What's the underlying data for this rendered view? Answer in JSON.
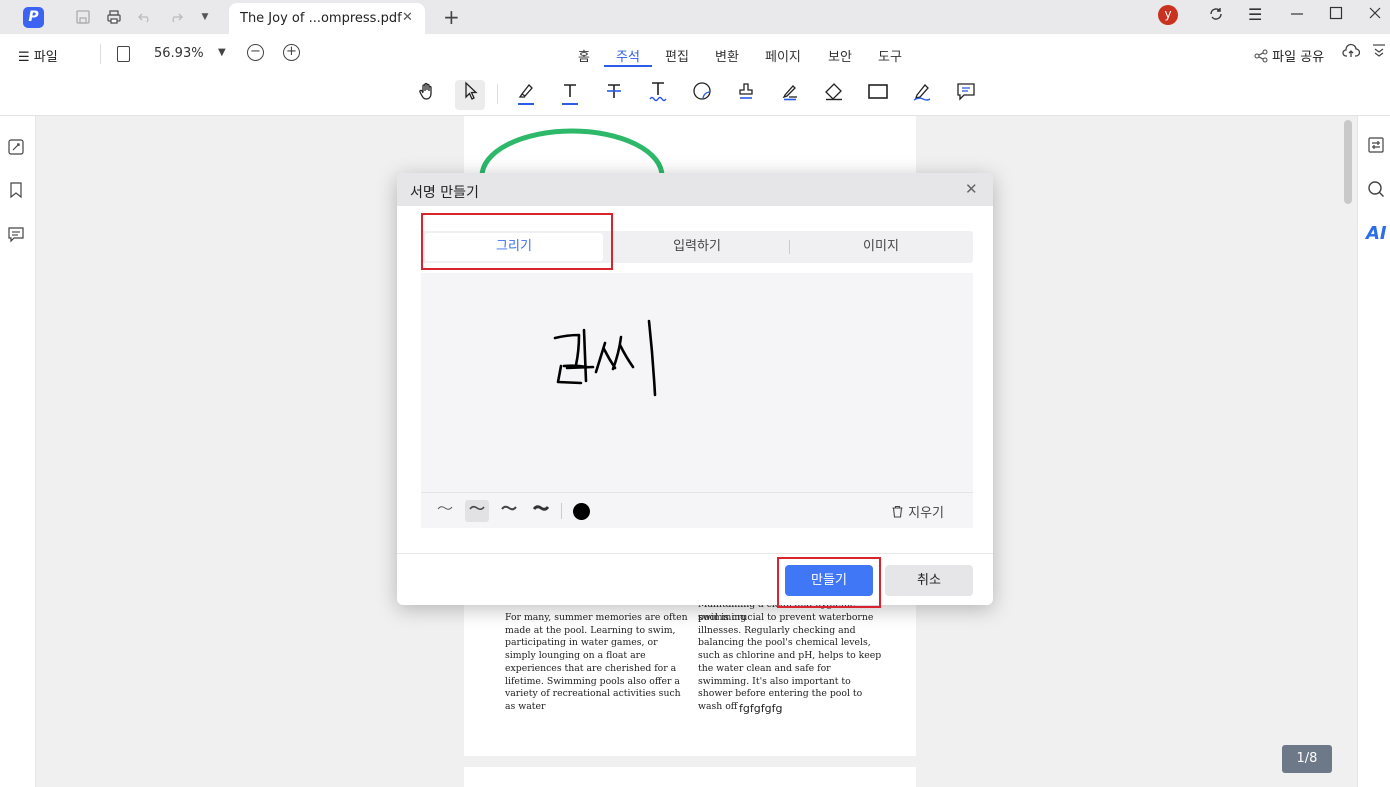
{
  "titlebar": {
    "tab_title": "The Joy of ...ompress.pdf",
    "avatar_letter": "y"
  },
  "menubar": {
    "file_label": "파일",
    "zoom": "56.93%",
    "tabs": [
      "홈",
      "주석",
      "편집",
      "변환",
      "페이지",
      "보안",
      "도구"
    ],
    "active_tab": "주석",
    "share_label": "파일 공유"
  },
  "toolbar": {
    "tools": [
      "hand-icon",
      "cursor-icon",
      "highlight-icon",
      "underline-text-icon",
      "strikethrough-icon",
      "squiggly-icon",
      "sticky-note-icon",
      "stamp-icon",
      "pencil-icon",
      "eraser-icon",
      "rectangle-icon",
      "signature-icon",
      "comment-icon"
    ],
    "selected_tool": "cursor-icon"
  },
  "right_sidebar": {
    "ai_label": "AI"
  },
  "pdf": {
    "col1": "For many, summer memories are often made at the pool. Learning to swim, participating in water games, or simply lounging on a float are experiences that are cherished for a lifetime. Swimming pools also offer a variety of recreational activities such as water",
    "col2_top": "Maintaining a clean and hygienic swimming",
    "col2": "pool is crucial to prevent waterborne illnesses. Regularly checking and balancing the pool's chemical levels, such as chlorine and pH, helps to keep the water clean and safe for swimming. It's also important to shower before entering the pool to wash off",
    "footer": "fgfgfgfg"
  },
  "page_counter": "1/8",
  "dialog": {
    "title": "서명 만들기",
    "tabs": [
      "그리기",
      "입력하기",
      "이미지"
    ],
    "active_tab": "그리기",
    "clear_label": "지우기",
    "pen_color": "#000000",
    "create_label": "만들기",
    "cancel_label": "취소"
  },
  "colors": {
    "accent": "#3b6ef5",
    "highlight_box": "#d9232d",
    "ellipse": "#2db86a"
  }
}
